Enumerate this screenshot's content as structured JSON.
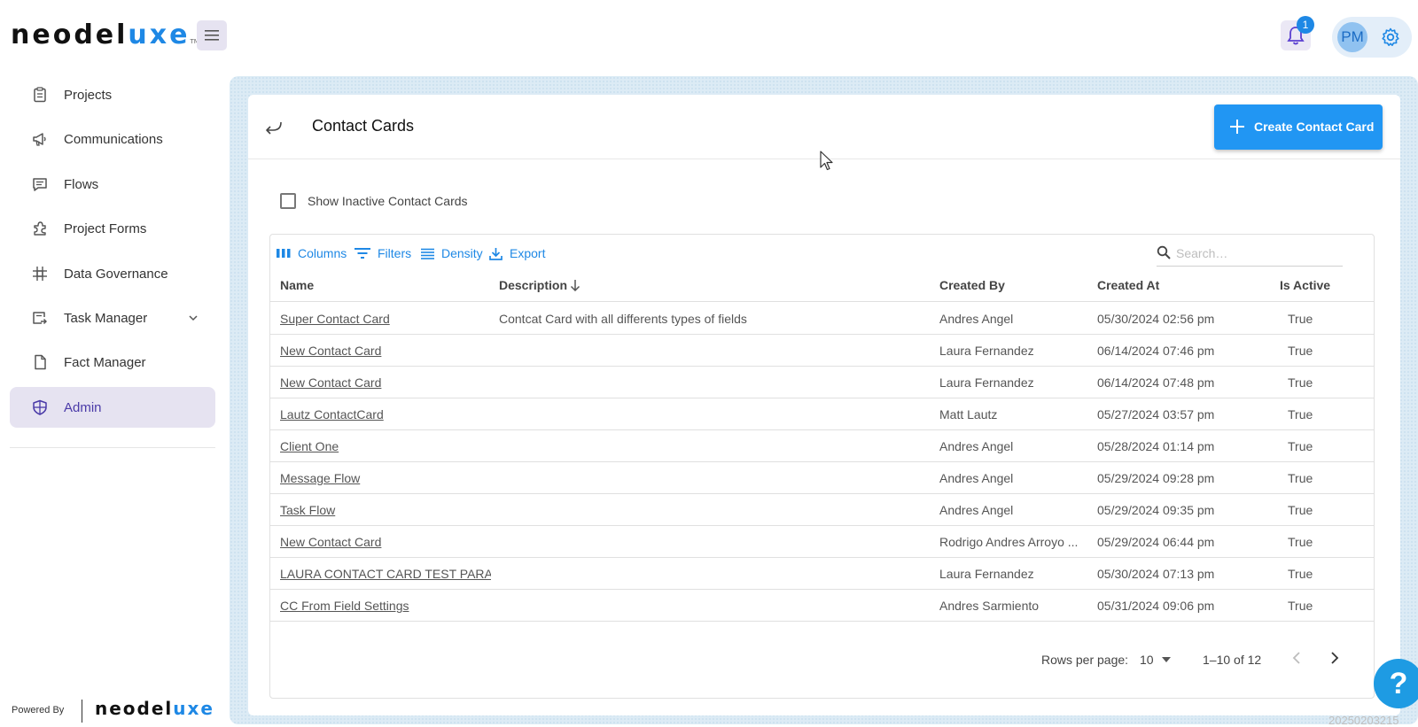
{
  "app": {
    "logo_text_1": "neodel",
    "logo_text_2": "u",
    "logo_text_3": "xe",
    "logo_tm": "TM",
    "notification_count": "1",
    "user_initials": "PM",
    "accent_color": "#1e88e5"
  },
  "sidebar": {
    "items": [
      {
        "label": "Projects",
        "icon": "clipboard-icon"
      },
      {
        "label": "Communications",
        "icon": "megaphone-icon"
      },
      {
        "label": "Flows",
        "icon": "chat-icon"
      },
      {
        "label": "Project Forms",
        "icon": "puzzle-icon"
      },
      {
        "label": "Data Governance",
        "icon": "grid-hash-icon"
      },
      {
        "label": "Task Manager",
        "icon": "task-icon"
      },
      {
        "label": "Fact Manager",
        "icon": "file-icon"
      },
      {
        "label": "Admin",
        "icon": "shield-icon"
      }
    ],
    "powered_by": "Powered By",
    "powered_logo_1": "neodel",
    "powered_logo_2": "u",
    "powered_logo_3": "xe"
  },
  "page": {
    "title": "Contact Cards",
    "create_button": "Create Contact Card",
    "show_inactive_label": "Show Inactive Contact Cards"
  },
  "toolbar": {
    "columns": "Columns",
    "filters": "Filters",
    "density": "Density",
    "export": "Export",
    "search_placeholder": "Search…"
  },
  "table": {
    "headers": {
      "name": "Name",
      "description": "Description",
      "created_by": "Created By",
      "created_at": "Created At",
      "is_active": "Is Active"
    },
    "rows": [
      {
        "name": "Super Contact Card",
        "description": "Contcat Card with all differents types of fields",
        "created_by": "Andres Angel",
        "created_at": "05/30/2024 02:56 pm",
        "is_active": "True"
      },
      {
        "name": "New Contact Card",
        "description": "",
        "created_by": "Laura Fernandez",
        "created_at": "06/14/2024 07:46 pm",
        "is_active": "True"
      },
      {
        "name": "New Contact Card",
        "description": "",
        "created_by": "Laura Fernandez",
        "created_at": "06/14/2024 07:48 pm",
        "is_active": "True"
      },
      {
        "name": "Lautz ContactCard",
        "description": "",
        "created_by": "Matt Lautz",
        "created_at": "05/27/2024 03:57 pm",
        "is_active": "True"
      },
      {
        "name": "Client One",
        "description": "",
        "created_by": "Andres Angel",
        "created_at": "05/28/2024 01:14 pm",
        "is_active": "True"
      },
      {
        "name": "Message Flow",
        "description": "",
        "created_by": "Andres Angel",
        "created_at": "05/29/2024 09:28 pm",
        "is_active": "True"
      },
      {
        "name": "Task Flow",
        "description": "",
        "created_by": "Andres Angel",
        "created_at": "05/29/2024 09:35 pm",
        "is_active": "True"
      },
      {
        "name": "New Contact Card",
        "description": "",
        "created_by": "Rodrigo Andres Arroyo ...",
        "created_at": "05/29/2024 06:44 pm",
        "is_active": "True"
      },
      {
        "name": "LAURA CONTACT CARD TEST PARA AI",
        "description": "",
        "created_by": "Laura Fernandez",
        "created_at": "05/30/2024 07:13 pm",
        "is_active": "True"
      },
      {
        "name": "CC From Field Settings",
        "description": "",
        "created_by": "Andres Sarmiento",
        "created_at": "05/31/2024 09:06 pm",
        "is_active": "True"
      }
    ]
  },
  "pagination": {
    "rows_per_page_label": "Rows per page:",
    "rows_per_page_value": "10",
    "range": "1–10 of 12"
  },
  "help_label": "?",
  "build_text": "20250203215"
}
